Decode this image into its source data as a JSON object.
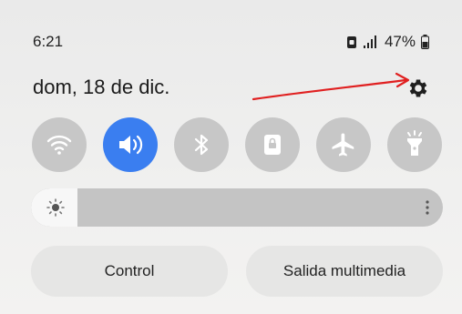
{
  "status_bar": {
    "time": "6:21",
    "battery_percent": "47%",
    "icons": [
      "lock-badge-icon",
      "signal-icon",
      "battery-icon"
    ]
  },
  "header": {
    "date": "dom, 18 de dic.",
    "settings_icon": "gear-icon",
    "annotation_color": "#e02020"
  },
  "quick_tiles": [
    {
      "icon": "wifi-icon",
      "active": false
    },
    {
      "icon": "sound-icon",
      "active": true
    },
    {
      "icon": "bluetooth-icon",
      "active": false
    },
    {
      "icon": "lock-rotation-icon",
      "active": false
    },
    {
      "icon": "airplane-icon",
      "active": false
    },
    {
      "icon": "flashlight-icon",
      "active": false
    }
  ],
  "brightness": {
    "icon": "sun-icon",
    "level_fraction": 0.09,
    "more_icon": "more-vertical-icon"
  },
  "buttons": {
    "control_label": "Control",
    "media_output_label": "Salida multimedia"
  },
  "colors": {
    "accent": "#3a7ef0",
    "tile_inactive": "#c7c7c7"
  }
}
